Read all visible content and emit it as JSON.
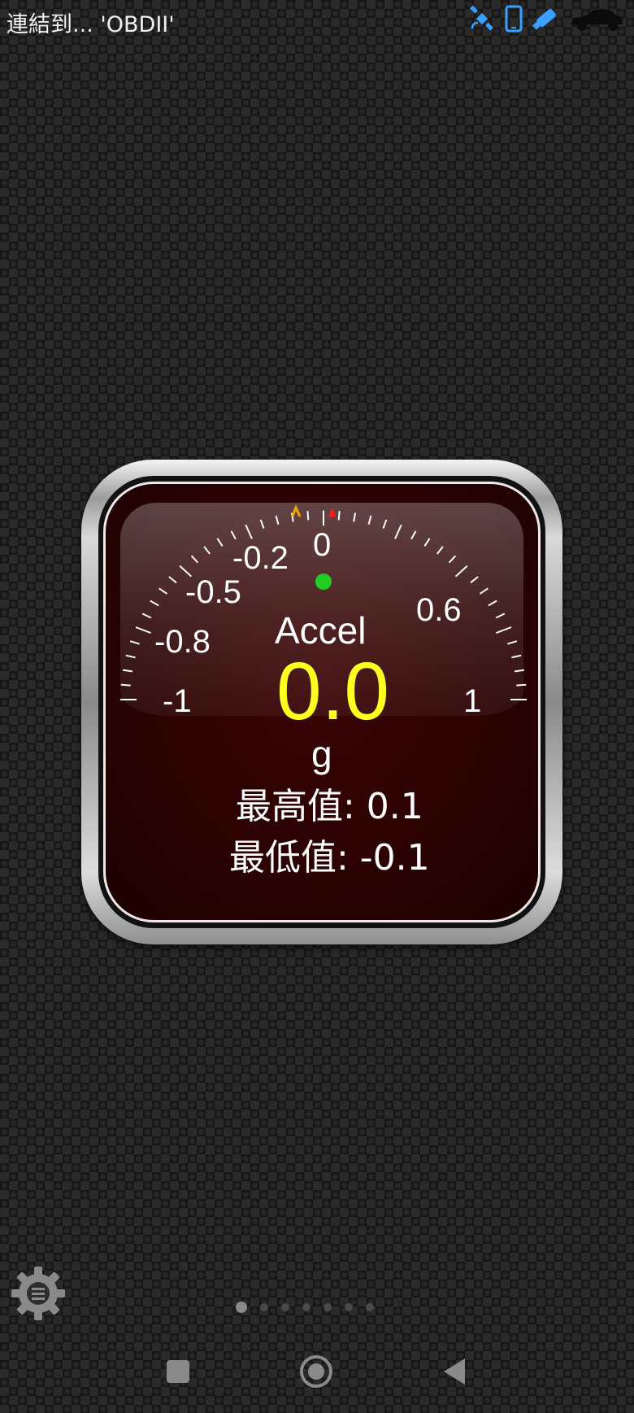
{
  "status_bar": {
    "connection_text": "連結到... 'OBDII'",
    "icons": [
      "satellite-icon",
      "phone-icon",
      "bluetooth-adapter-icon",
      "car-icon"
    ]
  },
  "gauge": {
    "title": "Accel",
    "value": "0.0",
    "unit": "g",
    "max_label": "最高值: 0.1",
    "min_label": "最低值: -0.1",
    "scale_labels": [
      "-1",
      "-0.8",
      "-0.5",
      "-0.2",
      "0",
      "0.6",
      "1"
    ],
    "scale_range": [
      -1,
      1
    ],
    "indicator_color": "#22cc22",
    "value_color": "#ffff22",
    "max_marker_color": "#ff1a1a",
    "min_marker_color": "#f2a500"
  },
  "pager": {
    "pages": 7,
    "current": 1
  },
  "nav": {
    "buttons": [
      "recents-button",
      "home-button",
      "back-button"
    ]
  }
}
